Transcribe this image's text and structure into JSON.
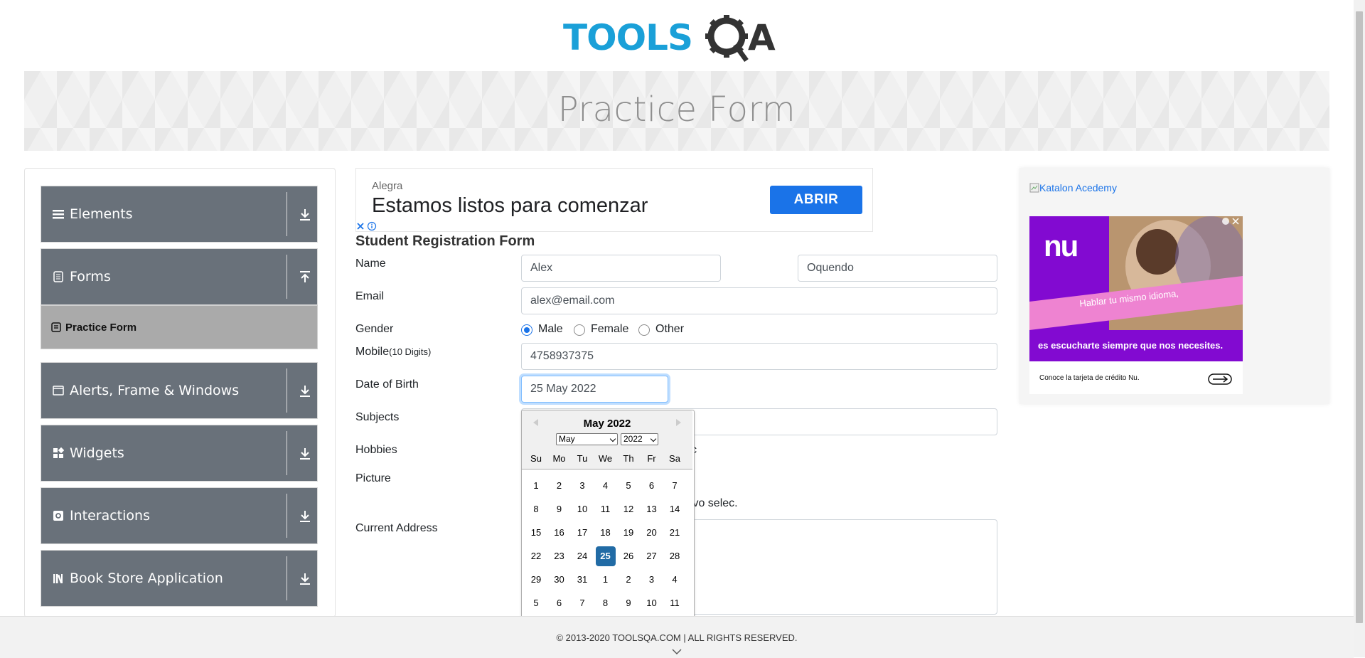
{
  "header": {
    "logo_text": "TOOLSQA"
  },
  "banner": {
    "title": "Practice Form"
  },
  "sidebar": {
    "groups": [
      {
        "label": "Elements",
        "icon": "hamburger-icon"
      },
      {
        "label": "Forms",
        "icon": "document-icon"
      },
      {
        "label": "Alerts, Frame & Windows",
        "icon": "window-icon"
      },
      {
        "label": "Widgets",
        "icon": "grid-icon"
      },
      {
        "label": "Interactions",
        "icon": "interaction-icon"
      },
      {
        "label": "Book Store Application",
        "icon": "books-icon"
      }
    ],
    "active_item": "Practice Form"
  },
  "ad_top": {
    "advertiser": "Alegra",
    "headline": "Estamos listos para comenzar",
    "cta": "ABRIR"
  },
  "form": {
    "title": "Student Registration Form",
    "labels": {
      "name": "Name",
      "email": "Email",
      "gender": "Gender",
      "mobile": "Mobile",
      "mobile_hint": "(10 Digits)",
      "dob": "Date of Birth",
      "subjects": "Subjects",
      "hobbies": "Hobbies",
      "picture": "Picture",
      "address": "Current Address"
    },
    "first_name": "Alex",
    "last_name": "Oquendo",
    "email": "alex@email.com",
    "gender_options": [
      "Male",
      "Female",
      "Other"
    ],
    "gender_selected": "Male",
    "mobile": "4758937375",
    "dob": "25 May 2022",
    "hobby_tail": "c",
    "picture_tail": "hivo selec."
  },
  "datepicker": {
    "title": "May 2022",
    "month_select": "May",
    "year_select": "2022",
    "day_names": [
      "Su",
      "Mo",
      "Tu",
      "We",
      "Th",
      "Fr",
      "Sa"
    ],
    "weeks": [
      [
        "1",
        "2",
        "3",
        "4",
        "5",
        "6",
        "7"
      ],
      [
        "8",
        "9",
        "10",
        "11",
        "12",
        "13",
        "14"
      ],
      [
        "15",
        "16",
        "17",
        "18",
        "19",
        "20",
        "21"
      ],
      [
        "22",
        "23",
        "24",
        "25",
        "26",
        "27",
        "28"
      ],
      [
        "29",
        "30",
        "31",
        "1",
        "2",
        "3",
        "4"
      ],
      [
        "5",
        "6",
        "7",
        "8",
        "9",
        "10",
        "11"
      ]
    ],
    "selected": "25"
  },
  "ad_right": {
    "alt_text": "Katalon Acedemy",
    "nu_logo": "nu",
    "line1": "Hablar tu mismo idioma,",
    "line2": "es escucharte siempre que nos necesites.",
    "footer": "Conoce la tarjeta de crédito Nu."
  },
  "footer": {
    "text": "© 2013-2020 TOOLSQA.COM | ALL RIGHTS RESERVED."
  },
  "colors": {
    "sidebar_group": "#69717a",
    "active_item": "#aaaaaa",
    "selected_day": "#216ba5",
    "cta": "#1a73e8",
    "nu_purple": "#820ad1"
  }
}
